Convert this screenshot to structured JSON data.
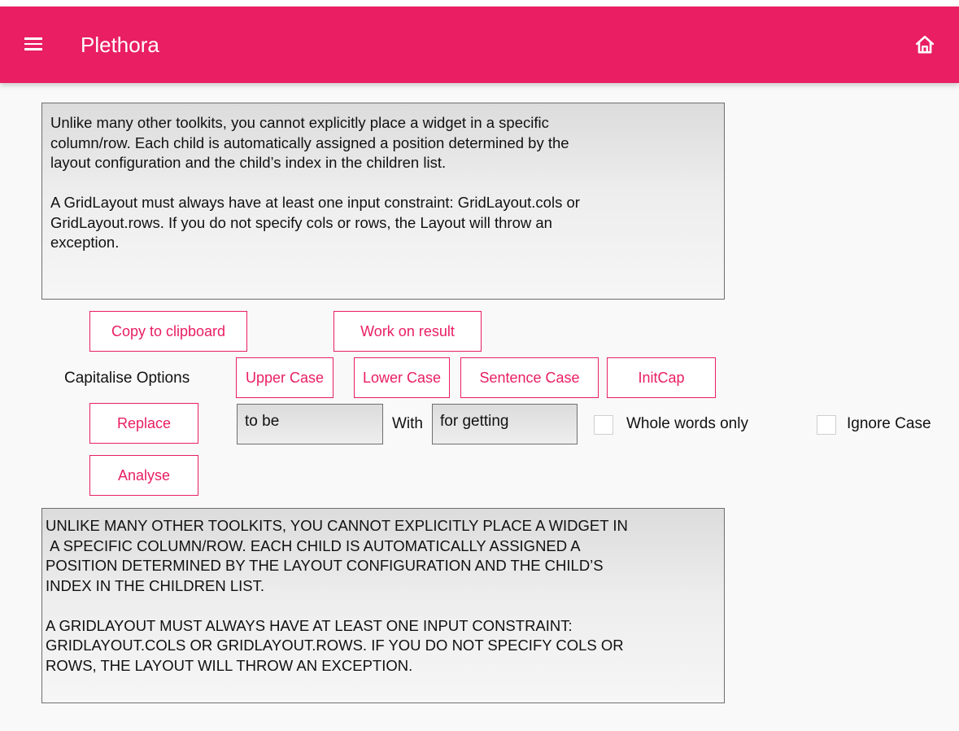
{
  "app": {
    "title": "Plethora",
    "menu_icon": "hamburger-menu-icon",
    "home_icon": "home-icon",
    "accent_color": "#e91e63"
  },
  "source_text": "Unlike many other toolkits, you cannot explicitly place a widget in a specific\ncolumn/row. Each child is automatically assigned a position determined by the\nlayout configuration and the child’s index in the children list.\n\nA GridLayout must always have at least one input constraint: GridLayout.cols or\nGridLayout.rows. If you do not specify cols or rows, the Layout will throw an\nexception.",
  "actions": {
    "copy_label": "Copy to clipboard",
    "work_on_result_label": "Work on result"
  },
  "capitalise": {
    "label": "Capitalise Options",
    "upper_label": "Upper Case",
    "lower_label": "Lower Case",
    "sentence_label": "Sentence Case",
    "initcap_label": "InitCap"
  },
  "replace": {
    "button_label": "Replace",
    "find_value": "to be",
    "with_label": "With",
    "replace_value": "for getting",
    "whole_words_label": "Whole words only",
    "whole_words_checked": false,
    "ignore_case_label": "Ignore Case",
    "ignore_case_checked": false
  },
  "analyse": {
    "button_label": "Analyse"
  },
  "result_text": "UNLIKE MANY OTHER TOOLKITS, YOU CANNOT EXPLICITLY PLACE A WIDGET IN\n A SPECIFIC COLUMN/ROW. EACH CHILD IS AUTOMATICALLY ASSIGNED A\nPOSITION DETERMINED BY THE LAYOUT CONFIGURATION AND THE CHILD’S\nINDEX IN THE CHILDREN LIST.\n\nA GRIDLAYOUT MUST ALWAYS HAVE AT LEAST ONE INPUT CONSTRAINT:\nGRIDLAYOUT.COLS OR GRIDLAYOUT.ROWS. IF YOU DO NOT SPECIFY COLS OR\nROWS, THE LAYOUT WILL THROW AN EXCEPTION."
}
